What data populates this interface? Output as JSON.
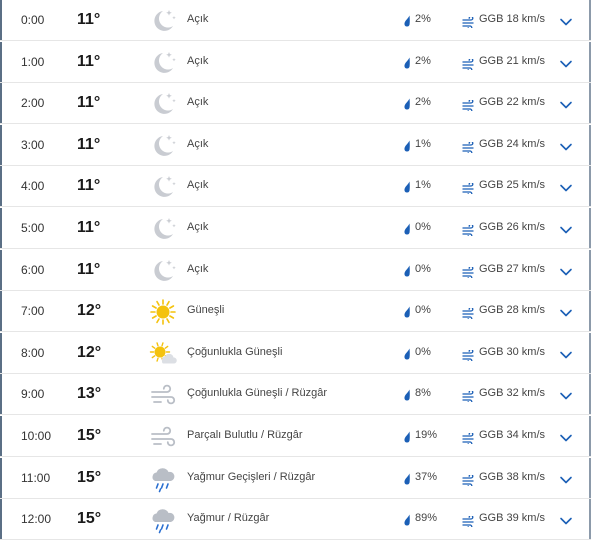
{
  "hours": [
    {
      "time": "0:00",
      "temp": "11°",
      "icon": "moon-stars-icon",
      "condition": "Açık",
      "precip": "2%",
      "wind": "GGB 18 km/s"
    },
    {
      "time": "1:00",
      "temp": "11°",
      "icon": "moon-stars-icon",
      "condition": "Açık",
      "precip": "2%",
      "wind": "GGB 21 km/s"
    },
    {
      "time": "2:00",
      "temp": "11°",
      "icon": "moon-stars-icon",
      "condition": "Açık",
      "precip": "2%",
      "wind": "GGB 22 km/s"
    },
    {
      "time": "3:00",
      "temp": "11°",
      "icon": "moon-stars-icon",
      "condition": "Açık",
      "precip": "1%",
      "wind": "GGB 24 km/s"
    },
    {
      "time": "4:00",
      "temp": "11°",
      "icon": "moon-stars-icon",
      "condition": "Açık",
      "precip": "1%",
      "wind": "GGB 25 km/s"
    },
    {
      "time": "5:00",
      "temp": "11°",
      "icon": "moon-stars-icon",
      "condition": "Açık",
      "precip": "0%",
      "wind": "GGB 26 km/s"
    },
    {
      "time": "6:00",
      "temp": "11°",
      "icon": "moon-stars-icon",
      "condition": "Açık",
      "precip": "0%",
      "wind": "GGB 27 km/s"
    },
    {
      "time": "7:00",
      "temp": "12°",
      "icon": "sun-icon",
      "condition": "Güneşli",
      "precip": "0%",
      "wind": "GGB 28 km/s"
    },
    {
      "time": "8:00",
      "temp": "12°",
      "icon": "sun-partly-cloudy-icon",
      "condition": "Çoğunlukla Güneşli",
      "precip": "0%",
      "wind": "GGB 30 km/s"
    },
    {
      "time": "9:00",
      "temp": "13°",
      "icon": "wind-icon",
      "condition": "Çoğunlukla Güneşli / Rüzgâr",
      "precip": "8%",
      "wind": "GGB 32 km/s"
    },
    {
      "time": "10:00",
      "temp": "15°",
      "icon": "wind-icon",
      "condition": "Parçalı Bulutlu / Rüzgâr",
      "precip": "19%",
      "wind": "GGB 34 km/s"
    },
    {
      "time": "11:00",
      "temp": "15°",
      "icon": "cloud-rain-icon",
      "condition": "Yağmur Geçişleri / Rüzgâr",
      "precip": "37%",
      "wind": "GGB 38 km/s"
    },
    {
      "time": "12:00",
      "temp": "15°",
      "icon": "cloud-rain-icon",
      "condition": "Yağmur / Rüzgâr",
      "precip": "89%",
      "wind": "GGB 39 km/s"
    }
  ],
  "colors": {
    "accent": "#1b5fb6",
    "moon": "#c9ccd2",
    "sun": "#f4c20d",
    "cloud": "#b9bec6",
    "rain": "#2a6fd1",
    "divider": "#e6e6e6"
  }
}
